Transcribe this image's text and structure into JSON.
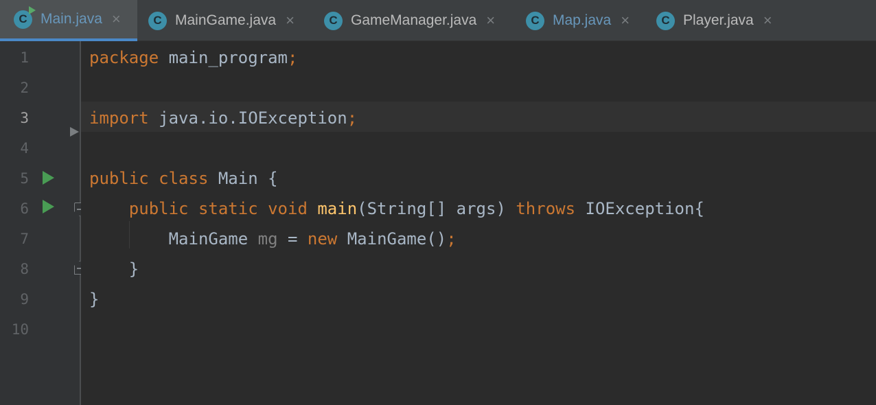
{
  "tabs": [
    {
      "label": "Main.java",
      "icon": "C",
      "active": true,
      "run_badge": true,
      "color": "#6897bb"
    },
    {
      "label": "MainGame.java",
      "icon": "C",
      "active": false
    },
    {
      "label": "GameManager.java",
      "icon": "C",
      "active": false
    },
    {
      "label": "Map.java",
      "icon": "C",
      "active": false,
      "color": "#6897bb"
    },
    {
      "label": "Player.java",
      "icon": "C",
      "active": false
    }
  ],
  "tab_close_glyph": "×",
  "current_line": 3,
  "line_numbers": [
    "1",
    "2",
    "3",
    "4",
    "5",
    "6",
    "7",
    "8",
    "9",
    "10"
  ],
  "code": {
    "l1": {
      "kw": "package",
      "rest": " main_program",
      "semi": ";"
    },
    "l3": {
      "kw": "import",
      "rest": " java.io.IOException",
      "semi": ";"
    },
    "l5": {
      "kw1": "public",
      "sp1": " ",
      "kw2": "class",
      "rest": " Main {"
    },
    "l6": {
      "indent": "    ",
      "kw1": "public",
      "kw2": " static",
      "kw3": " void",
      "sp": " ",
      "fn": "main",
      "args": "(String[] args) ",
      "kw4": "throws",
      "rest": " IOException{"
    },
    "l7": {
      "indent": "        ",
      "type": "MainGame ",
      "var": "mg",
      "eq": " = ",
      "kw": "new",
      "rest": " MainGame()",
      "semi": ";"
    },
    "l8": {
      "indent": "    ",
      "brace": "}"
    },
    "l9": {
      "brace": "}"
    }
  },
  "colors": {
    "keyword": "#cc7832",
    "function": "#ffc66d",
    "default_text": "#a9b7c6",
    "unused_var": "#808080",
    "run_icon": "#499c54",
    "tab_underline": "#4a88c7",
    "class_icon": "#3d8fa8"
  }
}
